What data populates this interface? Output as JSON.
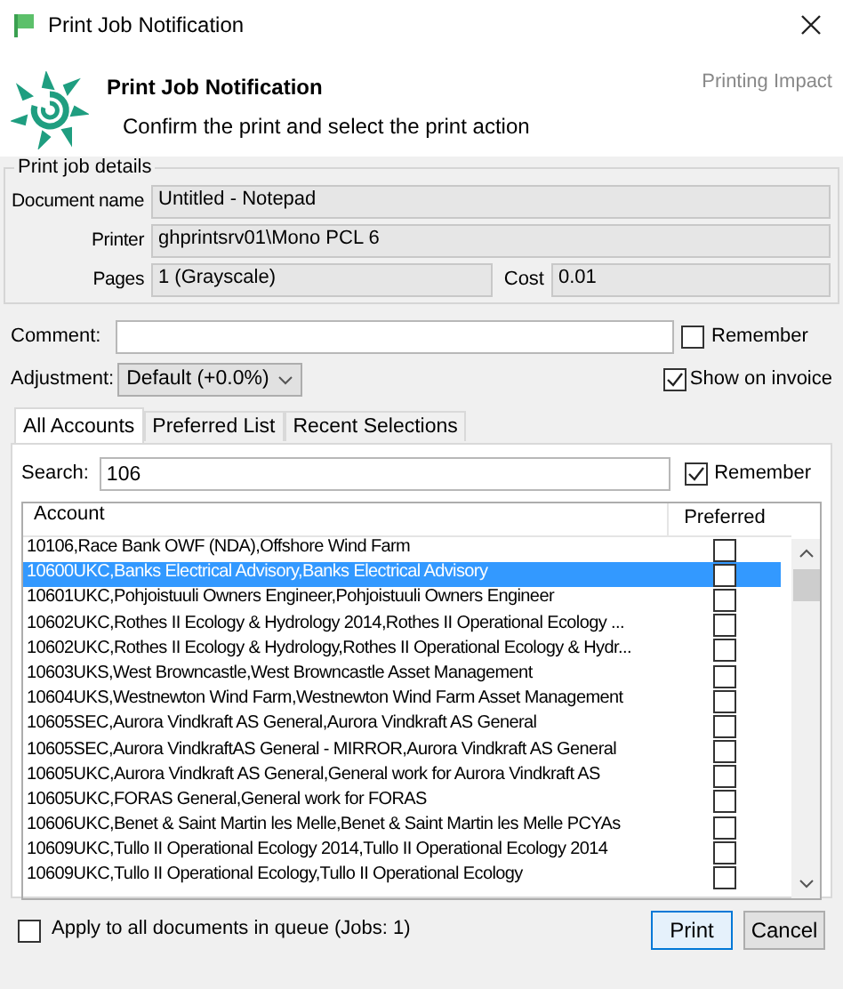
{
  "window": {
    "title": "Print Job Notification"
  },
  "header": {
    "title": "Print Job Notification",
    "subtitle": "Confirm the print and select the print action",
    "brand": "Printing Impact"
  },
  "details": {
    "legend": "Print job details",
    "document_label": "Document name",
    "document": "Untitled - Notepad",
    "printer_label": "Printer",
    "printer": "ghprintsrv01\\Mono PCL 6",
    "pages_label": "Pages",
    "pages": "1  (Grayscale)",
    "cost_label": "Cost",
    "cost": "0.01"
  },
  "comment": {
    "label": "Comment:",
    "remember": {
      "label": "Remember",
      "checked": false
    }
  },
  "adjustment": {
    "label": "Adjustment:",
    "value": "Default (+0.0%)",
    "show_on_invoice": {
      "label": "Show on invoice",
      "checked": true
    }
  },
  "tabs": [
    {
      "label": "All Accounts",
      "selected": true
    },
    {
      "label": "Preferred List",
      "selected": false
    },
    {
      "label": "Recent Selections",
      "selected": false
    }
  ],
  "search": {
    "label": "Search:",
    "value": "106",
    "remember": {
      "label": "Remember",
      "checked": true
    }
  },
  "table": {
    "columns": [
      "Account",
      "Preferred"
    ],
    "rows": [
      {
        "account": "10106,Race Bank OWF (NDA),Offshore Wind Farm",
        "preferred": false,
        "selected": false
      },
      {
        "account": "10600UKC,Banks Electrical Advisory,Banks Electrical Advisory",
        "preferred": false,
        "selected": true
      },
      {
        "account": "10601UKC,Pohjoistuuli Owners Engineer,Pohjoistuuli Owners Engineer",
        "preferred": false,
        "selected": false
      },
      {
        "account": "10602UKC,Rothes II Ecology & Hydrology 2014,Rothes II Operational Ecology ...",
        "preferred": false,
        "selected": false
      },
      {
        "account": "10602UKC,Rothes II Ecology & Hydrology,Rothes II Operational Ecology & Hydr...",
        "preferred": false,
        "selected": false
      },
      {
        "account": "10603UKS,West Browncastle,West Browncastle Asset Management",
        "preferred": false,
        "selected": false
      },
      {
        "account": "10604UKS,Westnewton Wind Farm,Westnewton Wind Farm Asset Management",
        "preferred": false,
        "selected": false
      },
      {
        "account": "10605SEC,Aurora Vindkraft AS General,Aurora Vindkraft AS General",
        "preferred": false,
        "selected": false
      },
      {
        "account": "10605SEC,Aurora VindkraftAS General - MIRROR,Aurora Vindkraft AS General",
        "preferred": false,
        "selected": false
      },
      {
        "account": "10605UKC,Aurora Vindkraft AS General,General work for Aurora Vindkraft AS",
        "preferred": false,
        "selected": false
      },
      {
        "account": "10605UKC,FORAS General,General work for FORAS",
        "preferred": false,
        "selected": false
      },
      {
        "account": "10606UKC,Benet & Saint Martin les Melle,Benet & Saint Martin les Melle PCYAs",
        "preferred": false,
        "selected": false
      },
      {
        "account": "10609UKC,Tullo II Operational Ecology 2014,Tullo II Operational Ecology 2014",
        "preferred": false,
        "selected": false
      },
      {
        "account": "10609UKC,Tullo II Operational Ecology,Tullo II Operational Ecology",
        "preferred": false,
        "selected": false
      }
    ]
  },
  "apply_all": {
    "label": "Apply to all documents in queue (Jobs: 1)",
    "checked": false
  },
  "buttons": [
    {
      "label": "Print",
      "default": true
    },
    {
      "label": "Cancel",
      "default": false
    }
  ]
}
